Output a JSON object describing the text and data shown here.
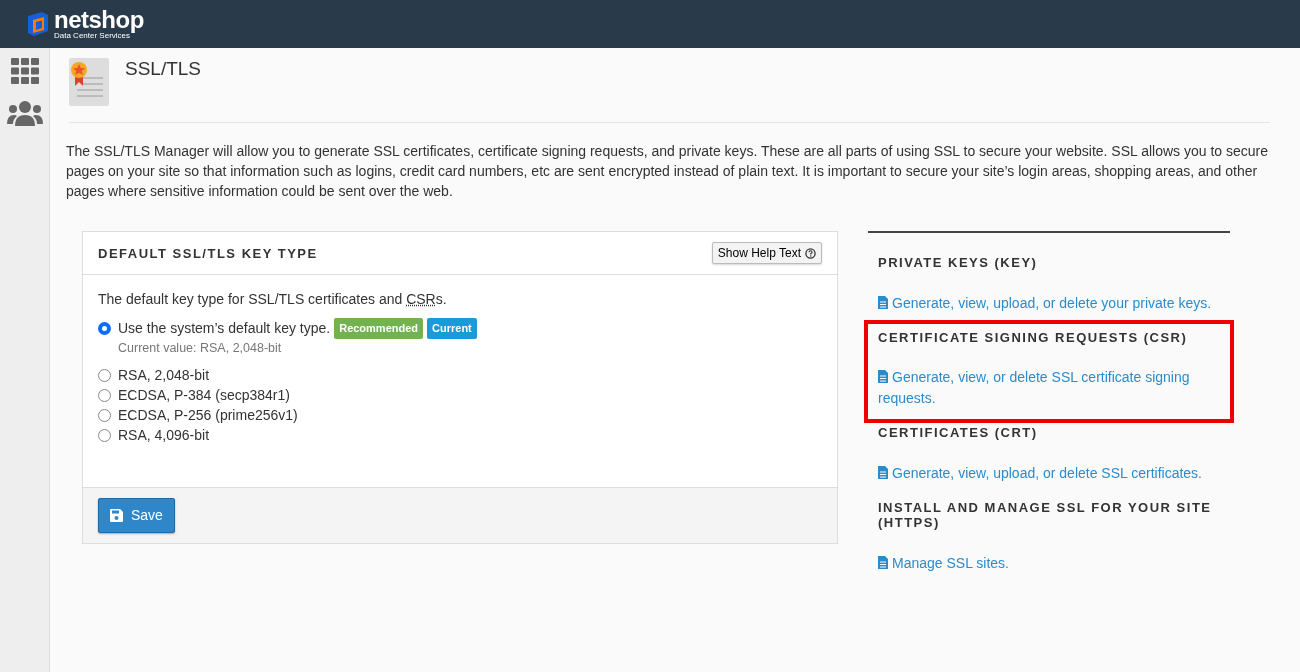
{
  "brand": {
    "name": "netshop",
    "tagline": "Data Center Services"
  },
  "page": {
    "title": "SSL/TLS",
    "intro": "The SSL/TLS Manager will allow you to generate SSL certificates, certificate signing requests, and private keys. These are all parts of using SSL to secure your website. SSL allows you to secure pages on your site so that information such as logins, credit card numbers, etc are sent encrypted instead of plain text. It is important to secure your site’s login areas, shopping areas, and other pages where sensitive information could be sent over the web."
  },
  "panel": {
    "title": "DEFAULT SSL/TLS KEY TYPE",
    "help_button": "Show Help Text",
    "description_before": "The default key type for SSL/TLS certificates and ",
    "description_abbr": "CSR",
    "description_after": "s.",
    "options": [
      {
        "label": "Use the system’s default key type.",
        "selected": true,
        "badges": [
          {
            "text": "Recommended",
            "kind": "success"
          },
          {
            "text": "Current",
            "kind": "info"
          }
        ],
        "note": "Current value: RSA, 2,048-bit"
      },
      {
        "label": "RSA, 2,048-bit",
        "selected": false
      },
      {
        "label": "ECDSA, P-384 (secp384r1)",
        "selected": false
      },
      {
        "label": "ECDSA, P-256 (prime256v1)",
        "selected": false
      },
      {
        "label": "RSA, 4,096-bit",
        "selected": false
      }
    ],
    "save_button": "Save"
  },
  "sections": [
    {
      "heading": "PRIVATE KEYS (KEY)",
      "link": "Generate, view, upload, or delete your private keys.",
      "highlighted": false
    },
    {
      "heading": "CERTIFICATE SIGNING REQUESTS (CSR)",
      "link": "Generate, view, or delete SSL certificate signing requests.",
      "highlighted": true
    },
    {
      "heading": "CERTIFICATES (CRT)",
      "link": "Generate, view, upload, or delete SSL certificates.",
      "highlighted": false
    },
    {
      "heading": "INSTALL AND MANAGE SSL FOR YOUR SITE (HTTPS)",
      "link": "Manage SSL sites.",
      "highlighted": false
    }
  ]
}
